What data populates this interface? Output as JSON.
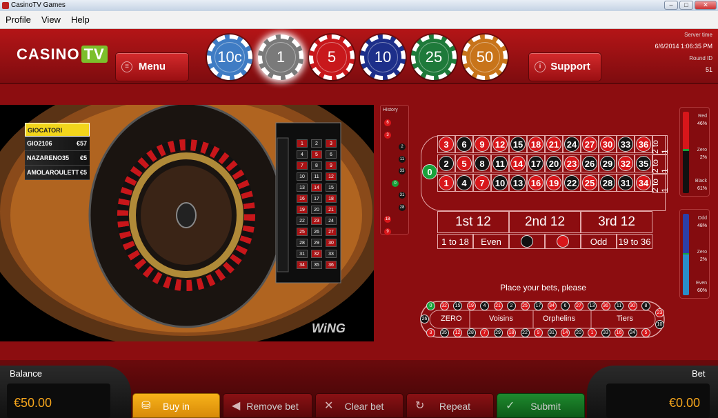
{
  "window": {
    "title": "CasinoTV Games"
  },
  "menu": [
    "Profile",
    "View",
    "Help"
  ],
  "header": {
    "logo_casino": "CASINO",
    "logo_tv": "TV",
    "menu_label": "Menu",
    "support_label": "Support",
    "server_time_label": "Server time",
    "server_time": "6/6/2014 1:06:35 PM",
    "round_label": "Round ID",
    "round_id": "51"
  },
  "chips": [
    {
      "label": "10c",
      "color": "#3f7cc4"
    },
    {
      "label": "1",
      "color": "#7a7a7a"
    },
    {
      "label": "5",
      "color": "#c8181c"
    },
    {
      "label": "10",
      "color": "#1d2f8a"
    },
    {
      "label": "25",
      "color": "#1e7a3a"
    },
    {
      "label": "50",
      "color": "#c8741a"
    }
  ],
  "video": {
    "players_header": "GIOCATORI",
    "players": [
      {
        "name": "GIO2106",
        "amount": "€57"
      },
      {
        "name": "NAZARENO35",
        "amount": "€5"
      },
      {
        "name": "AMOLAROULETT",
        "amount": "€5"
      }
    ],
    "watermark": "WiNG"
  },
  "history": {
    "label": "History",
    "numbers": [
      {
        "n": "6",
        "c": "r",
        "col": 0
      },
      {
        "n": "3",
        "c": "r",
        "col": 0
      },
      {
        "n": "2",
        "c": "b",
        "col": 2
      },
      {
        "n": "11",
        "c": "b",
        "col": 2
      },
      {
        "n": "33",
        "c": "b",
        "col": 2
      },
      {
        "n": "0",
        "c": "g",
        "col": 1
      },
      {
        "n": "31",
        "c": "b",
        "col": 2
      },
      {
        "n": "28",
        "c": "b",
        "col": 2
      },
      {
        "n": "18",
        "c": "r",
        "col": 0
      },
      {
        "n": "9",
        "c": "r",
        "col": 0
      }
    ]
  },
  "table": {
    "zero": "0",
    "rows": [
      [
        [
          "3",
          "r"
        ],
        [
          "6",
          "b"
        ],
        [
          "9",
          "r"
        ],
        [
          "12",
          "r"
        ],
        [
          "15",
          "b"
        ],
        [
          "18",
          "r"
        ],
        [
          "21",
          "r"
        ],
        [
          "24",
          "b"
        ],
        [
          "27",
          "r"
        ],
        [
          "30",
          "r"
        ],
        [
          "33",
          "b"
        ],
        [
          "36",
          "r"
        ]
      ],
      [
        [
          "2",
          "b"
        ],
        [
          "5",
          "r"
        ],
        [
          "8",
          "b"
        ],
        [
          "11",
          "b"
        ],
        [
          "14",
          "r"
        ],
        [
          "17",
          "b"
        ],
        [
          "20",
          "b"
        ],
        [
          "23",
          "r"
        ],
        [
          "26",
          "b"
        ],
        [
          "29",
          "b"
        ],
        [
          "32",
          "r"
        ],
        [
          "35",
          "b"
        ]
      ],
      [
        [
          "1",
          "r"
        ],
        [
          "4",
          "b"
        ],
        [
          "7",
          "r"
        ],
        [
          "10",
          "b"
        ],
        [
          "13",
          "b"
        ],
        [
          "16",
          "r"
        ],
        [
          "19",
          "r"
        ],
        [
          "22",
          "b"
        ],
        [
          "25",
          "r"
        ],
        [
          "28",
          "b"
        ],
        [
          "31",
          "b"
        ],
        [
          "34",
          "r"
        ]
      ]
    ],
    "column_bets": [
      "2 to 1",
      "2 to 1",
      "2 to 1"
    ],
    "dozens": [
      "1st 12",
      "2nd 12",
      "3rd 12"
    ],
    "outside": [
      "1 to 18",
      "Even",
      "",
      "",
      "Odd",
      "19 to 36"
    ],
    "outside_colors": {
      "black": "#111111",
      "red": "#d8161a"
    }
  },
  "place_bets": "Place your bets, please",
  "racetrack": {
    "top": [
      [
        "0",
        "g"
      ],
      [
        "32",
        "r"
      ],
      [
        "15",
        "b"
      ],
      [
        "19",
        "r"
      ],
      [
        "4",
        "b"
      ],
      [
        "21",
        "r"
      ],
      [
        "2",
        "b"
      ],
      [
        "25",
        "r"
      ],
      [
        "17",
        "b"
      ],
      [
        "34",
        "r"
      ],
      [
        "6",
        "b"
      ],
      [
        "27",
        "r"
      ],
      [
        "13",
        "b"
      ],
      [
        "36",
        "r"
      ],
      [
        "11",
        "b"
      ],
      [
        "30",
        "r"
      ],
      [
        "8",
        "b"
      ]
    ],
    "bottom": [
      [
        "3",
        "r"
      ],
      [
        "35",
        "b"
      ],
      [
        "12",
        "r"
      ],
      [
        "28",
        "b"
      ],
      [
        "7",
        "r"
      ],
      [
        "29",
        "b"
      ],
      [
        "18",
        "r"
      ],
      [
        "22",
        "b"
      ],
      [
        "9",
        "r"
      ],
      [
        "31",
        "b"
      ],
      [
        "14",
        "r"
      ],
      [
        "20",
        "b"
      ],
      [
        "1",
        "r"
      ],
      [
        "33",
        "b"
      ],
      [
        "16",
        "r"
      ],
      [
        "24",
        "b"
      ],
      [
        "5",
        "r"
      ]
    ],
    "left": [
      [
        "26",
        "b"
      ]
    ],
    "right": [
      [
        "23",
        "r"
      ],
      [
        "10",
        "b"
      ]
    ],
    "sectors": [
      "ZERO",
      "Voisins",
      "Orphelins",
      "Tiers"
    ]
  },
  "stats_color": {
    "red_label": "Red",
    "red": "46%",
    "zero_label": "Zero",
    "zero": "2%",
    "black_label": "Black",
    "black": "61%"
  },
  "stats_parity": {
    "odd_label": "Odd",
    "odd": "48%",
    "zero_label": "Zero",
    "zero": "2%",
    "even_label": "Even",
    "even": "60%"
  },
  "footer": {
    "balance_label": "Balance",
    "balance": "€50.00",
    "bet_label": "Bet",
    "bet": "€0.00",
    "buyin": "Buy in",
    "remove": "Remove bet",
    "clear": "Clear bet",
    "repeat": "Repeat",
    "submit": "Submit"
  }
}
